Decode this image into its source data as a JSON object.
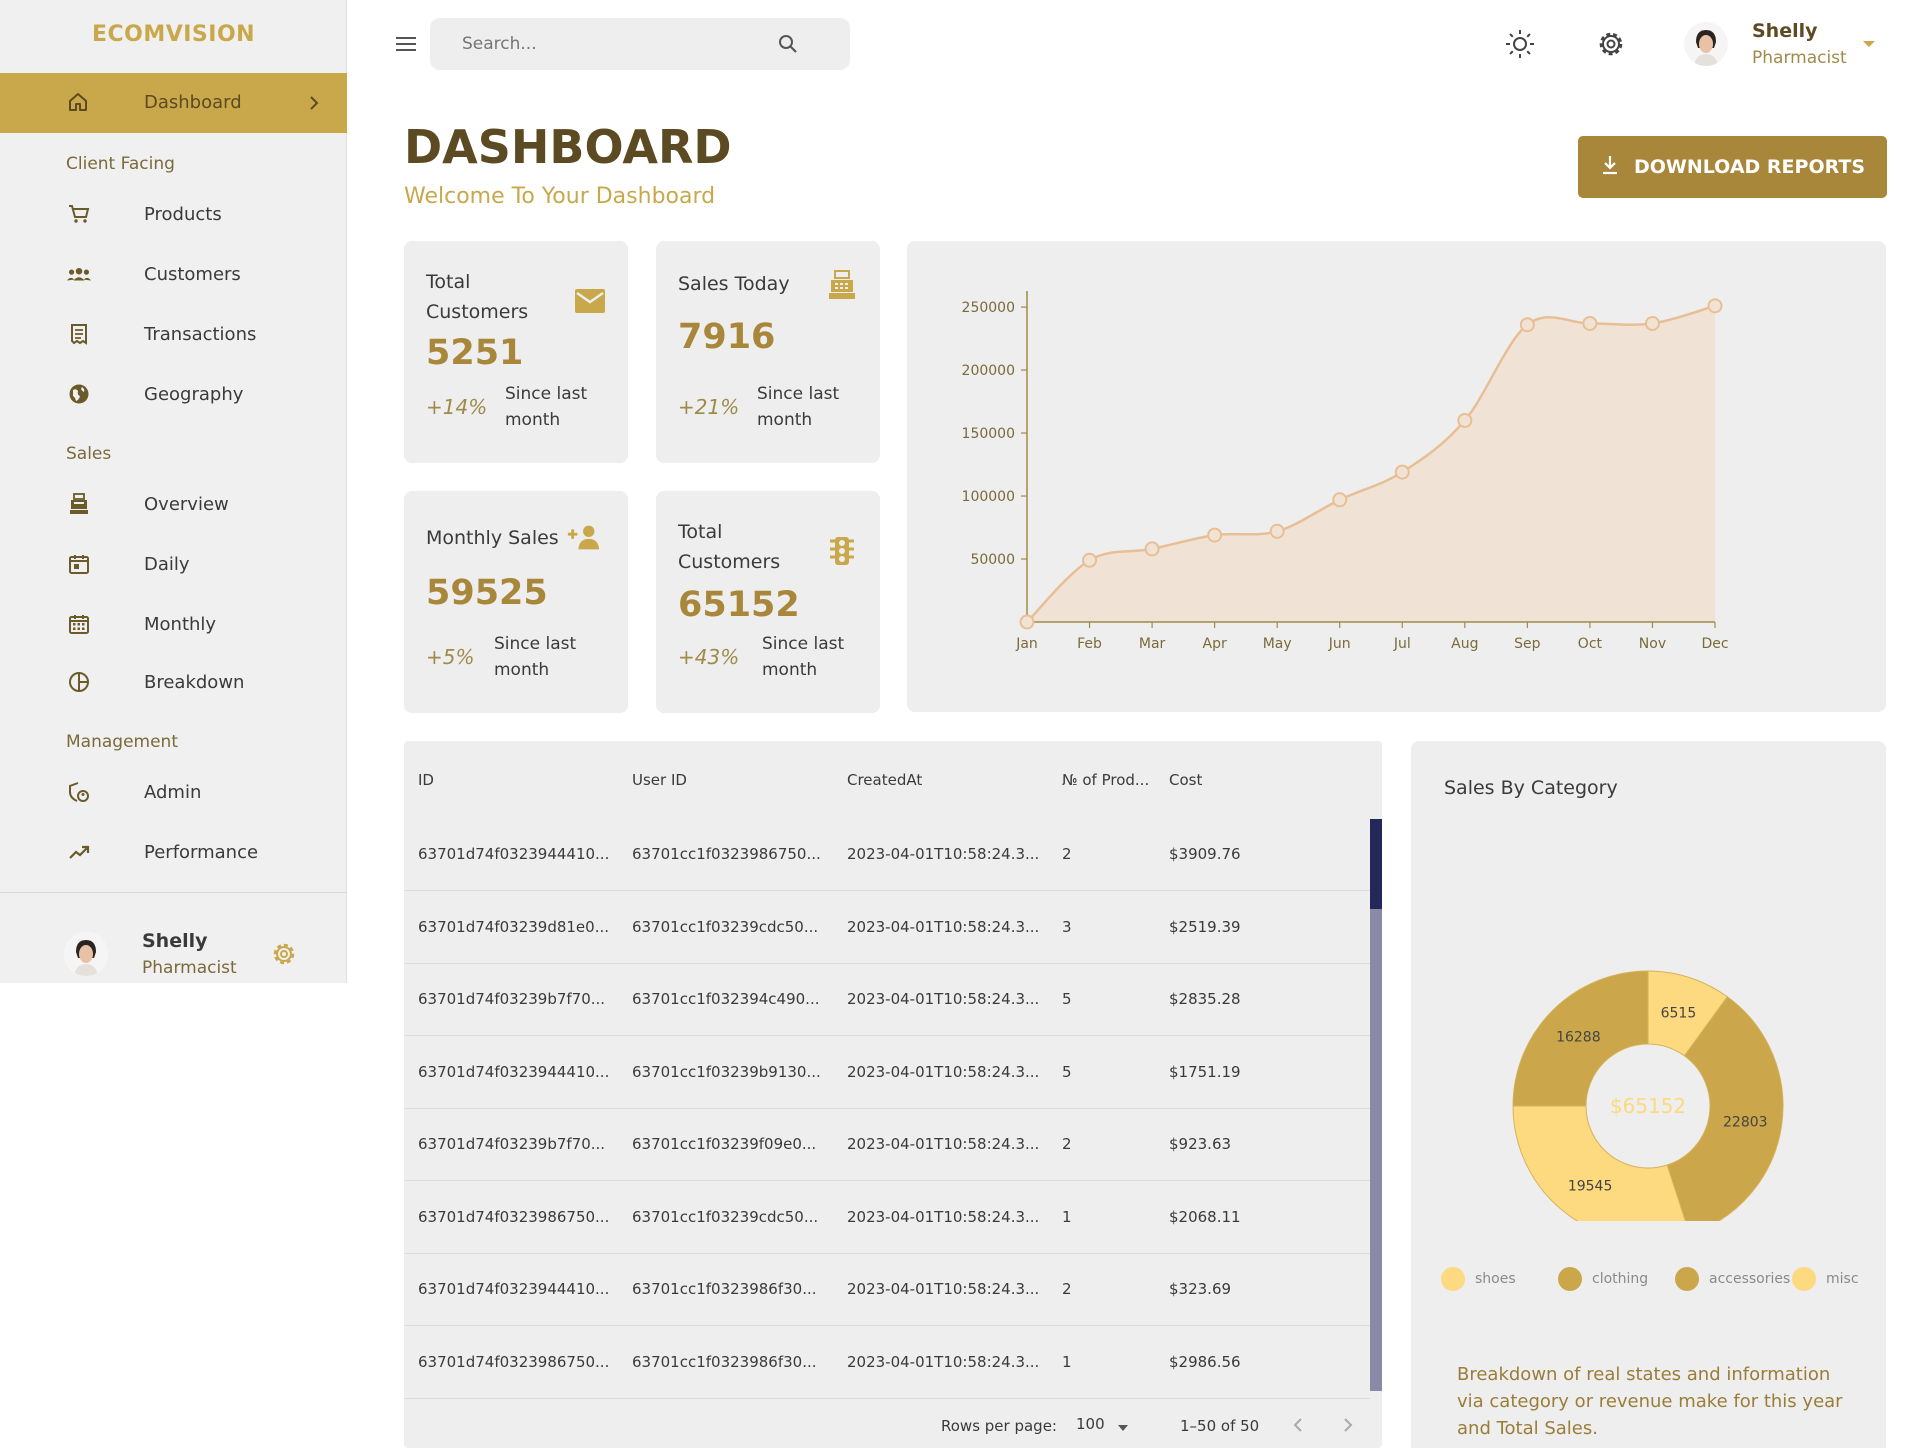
{
  "brand": "ECOMVISION",
  "colors": {
    "accent": "#c9a84c",
    "accent_dark": "#a8873a",
    "title": "#5b4a22",
    "panel": "#eeeeee"
  },
  "sidebar": {
    "active_item": {
      "label": "Dashboard",
      "icon": "home-icon"
    },
    "sections": [
      {
        "title": "Client Facing",
        "items": [
          {
            "label": "Products",
            "icon": "cart-icon"
          },
          {
            "label": "Customers",
            "icon": "group-icon"
          },
          {
            "label": "Transactions",
            "icon": "receipt-icon"
          },
          {
            "label": "Geography",
            "icon": "globe-icon"
          }
        ]
      },
      {
        "title": "Sales",
        "items": [
          {
            "label": "Overview",
            "icon": "point-of-sale-icon"
          },
          {
            "label": "Daily",
            "icon": "calendar-day-icon"
          },
          {
            "label": "Monthly",
            "icon": "calendar-month-icon"
          },
          {
            "label": "Breakdown",
            "icon": "pie-chart-icon"
          }
        ]
      },
      {
        "title": "Management",
        "items": [
          {
            "label": "Admin",
            "icon": "admin-icon"
          },
          {
            "label": "Performance",
            "icon": "trending-up-icon"
          }
        ]
      }
    ],
    "user": {
      "name": "Shelly",
      "role": "Pharmacist"
    }
  },
  "topbar": {
    "search_placeholder": "Search...",
    "user": {
      "name": "Shelly",
      "role": "Pharmacist"
    }
  },
  "header": {
    "title": "DASHBOARD",
    "subtitle": "Welcome To Your Dashboard",
    "download_label": "DOWNLOAD REPORTS"
  },
  "stats": [
    {
      "title_line1": "Total",
      "title_line2": "Customers",
      "value": "5251",
      "pct": "+14%",
      "since_line1": "Since last",
      "since_line2": "month",
      "icon": "email-icon"
    },
    {
      "title_line1": "Sales Today",
      "title_line2": "",
      "value": "7916",
      "pct": "+21%",
      "since_line1": "Since last",
      "since_line2": "month",
      "icon": "point-of-sale-icon"
    },
    {
      "title_line1": "Monthly Sales",
      "title_line2": "",
      "value": "59525",
      "pct": "+5%",
      "since_line1": "Since last",
      "since_line2": "month",
      "icon": "person-add-icon"
    },
    {
      "title_line1": "Total",
      "title_line2": "Customers",
      "value": "65152",
      "pct": "+43%",
      "since_line1": "Since last",
      "since_line2": "month",
      "icon": "traffic-icon"
    }
  ],
  "chart_data": [
    {
      "type": "area",
      "categories": [
        "Jan",
        "Feb",
        "Mar",
        "Apr",
        "May",
        "Jun",
        "Jul",
        "Aug",
        "Sep",
        "Oct",
        "Nov",
        "Dec"
      ],
      "values": [
        0,
        49000,
        58000,
        69000,
        72000,
        97000,
        119000,
        160000,
        236000,
        237000,
        237000,
        251000
      ],
      "yticks": [
        50000,
        100000,
        150000,
        200000,
        250000
      ],
      "ylim": [
        0,
        250000
      ],
      "grid": false,
      "color": "#e8bf95"
    },
    {
      "type": "pie",
      "title": "Sales By Category",
      "center_label": "$65152",
      "slices": [
        {
          "name": "shoes",
          "value": 6515,
          "color": "#fdd980"
        },
        {
          "name": "clothing",
          "value": 22803,
          "color": "#cba64b"
        },
        {
          "name": "accessories",
          "value": 19545,
          "color": "#fdd980"
        },
        {
          "name": "misc",
          "value": 16288,
          "color": "#cba64b"
        }
      ],
      "legend": [
        {
          "name": "shoes",
          "color": "#fdd980"
        },
        {
          "name": "clothing",
          "color": "#cba64b"
        },
        {
          "name": "accessories",
          "color": "#cba64b"
        },
        {
          "name": "misc",
          "color": "#fdd980"
        }
      ]
    }
  ],
  "table": {
    "headers": [
      "ID",
      "User ID",
      "CreatedAt",
      "№ of Prod...",
      "Cost"
    ],
    "rows": [
      [
        "63701d74f0323944410...",
        "63701cc1f0323986750...",
        "2023-04-01T10:58:24.3...",
        "2",
        "$3909.76"
      ],
      [
        "63701d74f03239d81e0...",
        "63701cc1f03239cdc50...",
        "2023-04-01T10:58:24.3...",
        "3",
        "$2519.39"
      ],
      [
        "63701d74f03239b7f70...",
        "63701cc1f032394c490...",
        "2023-04-01T10:58:24.3...",
        "5",
        "$2835.28"
      ],
      [
        "63701d74f0323944410...",
        "63701cc1f03239b9130...",
        "2023-04-01T10:58:24.3...",
        "5",
        "$1751.19"
      ],
      [
        "63701d74f03239b7f70...",
        "63701cc1f03239f09e0...",
        "2023-04-01T10:58:24.3...",
        "2",
        "$923.63"
      ],
      [
        "63701d74f0323986750...",
        "63701cc1f03239cdc50...",
        "2023-04-01T10:58:24.3...",
        "1",
        "$2068.11"
      ],
      [
        "63701d74f0323944410...",
        "63701cc1f0323986f30...",
        "2023-04-01T10:58:24.3...",
        "2",
        "$323.69"
      ],
      [
        "63701d74f0323986750...",
        "63701cc1f0323986f30...",
        "2023-04-01T10:58:24.3...",
        "1",
        "$2986.56"
      ]
    ],
    "rows_per_page_label": "Rows per page:",
    "rows_per_page_value": "100",
    "range_label": "1–50 of 50"
  },
  "pie_description": "Breakdown of real states and information via category or revenue make for this year and Total Sales."
}
